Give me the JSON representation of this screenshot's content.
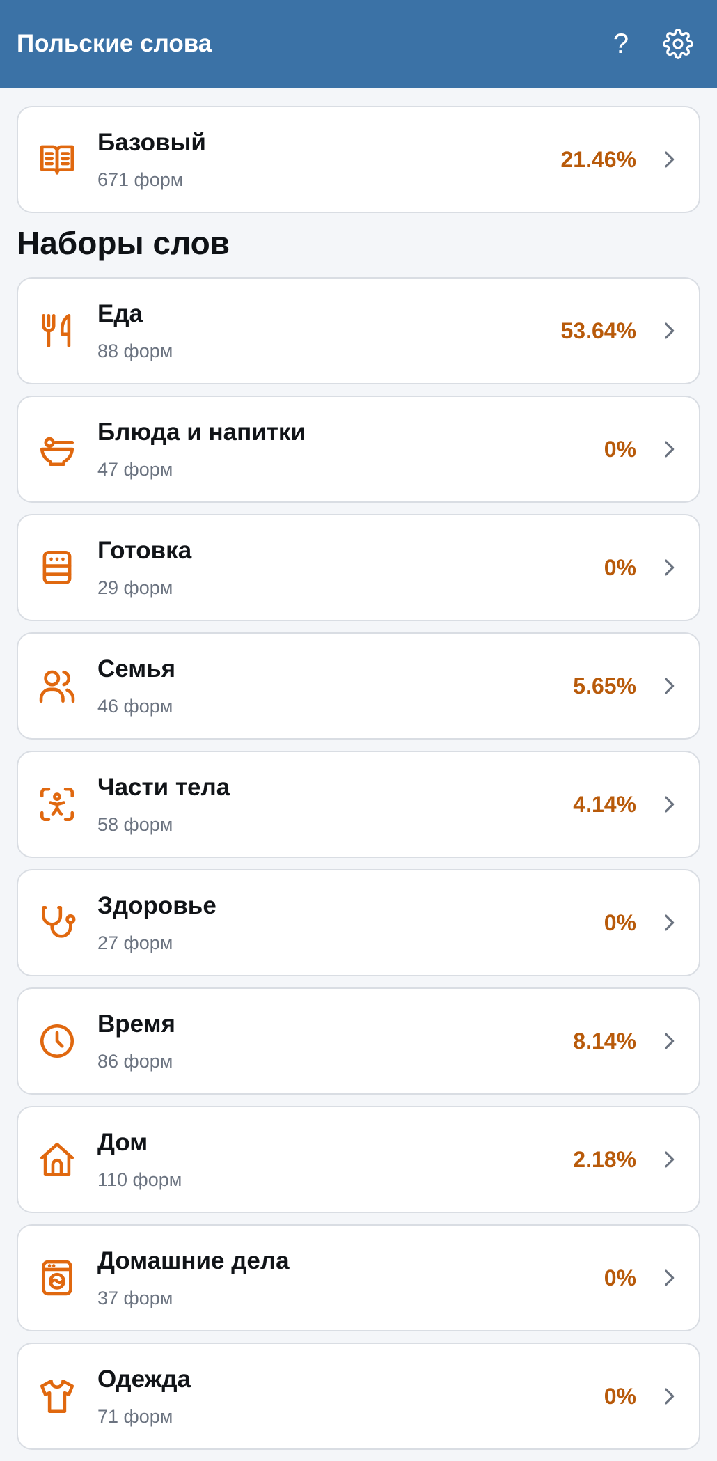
{
  "header": {
    "title": "Польские слова",
    "help_label": "?",
    "accent_color": "#3b72a6"
  },
  "base_set": {
    "name": "Базовый",
    "forms": "671 форм",
    "percent": "21.46%",
    "icon": "open-book-icon"
  },
  "section_title": "Наборы слов",
  "sets": [
    {
      "name": "Еда",
      "forms": "88 форм",
      "percent": "53.64%",
      "icon": "cutlery-icon"
    },
    {
      "name": "Блюда и напитки",
      "forms": "47 форм",
      "percent": "0%",
      "icon": "bowl-icon"
    },
    {
      "name": "Готовка",
      "forms": "29 форм",
      "percent": "0%",
      "icon": "stove-icon"
    },
    {
      "name": "Семья",
      "forms": "46 форм",
      "percent": "5.65%",
      "icon": "people-icon"
    },
    {
      "name": "Части тела",
      "forms": "58 форм",
      "percent": "4.14%",
      "icon": "body-scan-icon"
    },
    {
      "name": "Здоровье",
      "forms": "27 форм",
      "percent": "0%",
      "icon": "stethoscope-icon"
    },
    {
      "name": "Время",
      "forms": "86 форм",
      "percent": "8.14%",
      "icon": "clock-icon"
    },
    {
      "name": "Дом",
      "forms": "110 форм",
      "percent": "2.18%",
      "icon": "house-icon"
    },
    {
      "name": "Домашние дела",
      "forms": "37 форм",
      "percent": "0%",
      "icon": "washing-machine-icon"
    },
    {
      "name": "Одежда",
      "forms": "71 форм",
      "percent": "0%",
      "icon": "shirt-icon"
    }
  ],
  "colors": {
    "icon_orange": "#e0680f",
    "percent_orange": "#b85a0a",
    "muted_text": "#6b7380"
  }
}
